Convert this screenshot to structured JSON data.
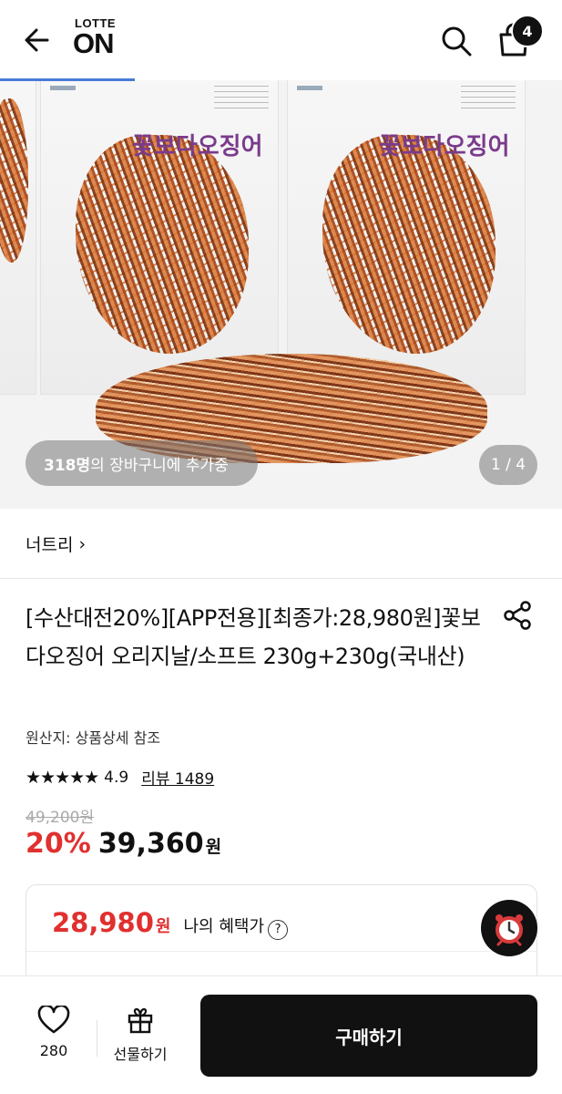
{
  "header": {
    "logo_top": "LOTTE",
    "logo_bottom": "ON",
    "cart_count": "4",
    "icons": {
      "back": "arrow-left-icon",
      "search": "search-icon",
      "cart": "shopping-bag-icon"
    }
  },
  "hero": {
    "cart_count_bold": "318명",
    "cart_count_rest": "의 장바구니에 추가중",
    "image_counter": "1 / 4",
    "package_brand": "꽃보다오징어"
  },
  "seller": {
    "name": "너트리",
    "chevron": "›"
  },
  "product": {
    "title": "[수산대전20%][APP전용][최종가:28,980원]꽃보다오징어 오리지날/소프트 230g+230g(국내산)",
    "origin": "원산지: 상품상세 참조",
    "stars": "★★★★★",
    "rating": "4.9",
    "review_label": "리뷰 1489",
    "original_price": "49,200원",
    "discount": "20%",
    "price": "39,360",
    "price_unit": "원"
  },
  "benefit": {
    "price": "28,980",
    "unit": "원",
    "label": "나의 혜택가",
    "help": "?"
  },
  "bottom_bar": {
    "like_count": "280",
    "gift_label": "선물하기",
    "buy_label": "구매하기"
  },
  "colors": {
    "accent_red": "#e0302f",
    "dark": "#111111",
    "progress": "#4a7bd6"
  }
}
